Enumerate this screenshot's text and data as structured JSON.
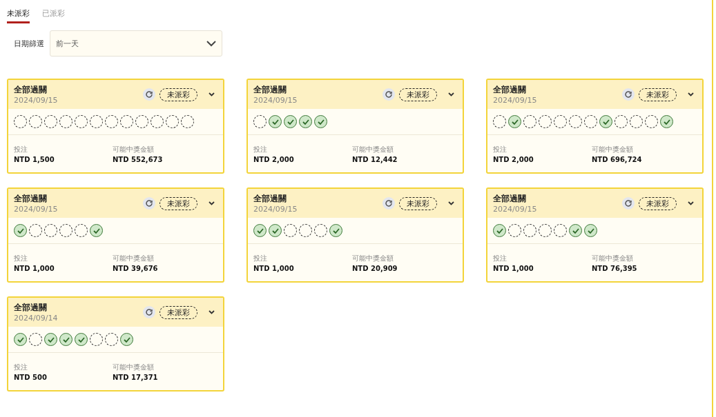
{
  "tabs": [
    {
      "label": "未派彩",
      "selected": true
    },
    {
      "label": "已派彩",
      "selected": false
    }
  ],
  "date_filter": {
    "label": "日期篩選",
    "value": "前一天"
  },
  "bets": [
    {
      "title": "全部過關",
      "date": "2024/09/15",
      "status": "未派彩",
      "stake_label": "投注",
      "stake": "NTD 1,500",
      "payout_label": "可能中獎金額",
      "payout": "NTD 552,673",
      "legs": [
        {
          "won": false
        },
        {
          "won": false
        },
        {
          "won": false
        },
        {
          "won": false
        },
        {
          "won": false
        },
        {
          "won": false
        },
        {
          "won": false
        },
        {
          "won": false
        },
        {
          "won": false
        },
        {
          "won": false
        },
        {
          "won": false
        },
        {
          "won": false
        }
      ]
    },
    {
      "title": "全部過關",
      "date": "2024/09/15",
      "status": "未派彩",
      "stake_label": "投注",
      "stake": "NTD 2,000",
      "payout_label": "可能中獎金額",
      "payout": "NTD 12,442",
      "legs": [
        {
          "won": false
        },
        {
          "won": true
        },
        {
          "won": true
        },
        {
          "won": true
        },
        {
          "won": true
        }
      ]
    },
    {
      "title": "全部過關",
      "date": "2024/09/15",
      "status": "未派彩",
      "stake_label": "投注",
      "stake": "NTD 2,000",
      "payout_label": "可能中獎金額",
      "payout": "NTD 696,724",
      "legs": [
        {
          "won": false
        },
        {
          "won": true
        },
        {
          "won": false
        },
        {
          "won": false
        },
        {
          "won": false
        },
        {
          "won": false
        },
        {
          "won": false
        },
        {
          "won": true
        },
        {
          "won": false
        },
        {
          "won": false
        },
        {
          "won": false
        },
        {
          "won": true
        }
      ]
    },
    {
      "title": "全部過關",
      "date": "2024/09/15",
      "status": "未派彩",
      "stake_label": "投注",
      "stake": "NTD 1,000",
      "payout_label": "可能中獎金額",
      "payout": "NTD 39,676",
      "legs": [
        {
          "won": true
        },
        {
          "won": false
        },
        {
          "won": false
        },
        {
          "won": false
        },
        {
          "won": false
        },
        {
          "won": true
        }
      ]
    },
    {
      "title": "全部過關",
      "date": "2024/09/15",
      "status": "未派彩",
      "stake_label": "投注",
      "stake": "NTD 1,000",
      "payout_label": "可能中獎金額",
      "payout": "NTD 20,909",
      "legs": [
        {
          "won": true
        },
        {
          "won": true
        },
        {
          "won": false
        },
        {
          "won": false
        },
        {
          "won": false
        },
        {
          "won": true
        }
      ]
    },
    {
      "title": "全部過關",
      "date": "2024/09/15",
      "status": "未派彩",
      "stake_label": "投注",
      "stake": "NTD 1,000",
      "payout_label": "可能中獎金額",
      "payout": "NTD 76,395",
      "legs": [
        {
          "won": true
        },
        {
          "won": false
        },
        {
          "won": false
        },
        {
          "won": false
        },
        {
          "won": false
        },
        {
          "won": true
        },
        {
          "won": true
        }
      ]
    },
    {
      "title": "全部過關",
      "date": "2024/09/14",
      "status": "未派彩",
      "stake_label": "投注",
      "stake": "NTD 500",
      "payout_label": "可能中獎金額",
      "payout": "NTD 17,371",
      "legs": [
        {
          "won": true
        },
        {
          "won": false
        },
        {
          "won": true
        },
        {
          "won": true
        },
        {
          "won": true
        },
        {
          "won": false
        },
        {
          "won": false
        },
        {
          "won": true
        }
      ]
    }
  ]
}
